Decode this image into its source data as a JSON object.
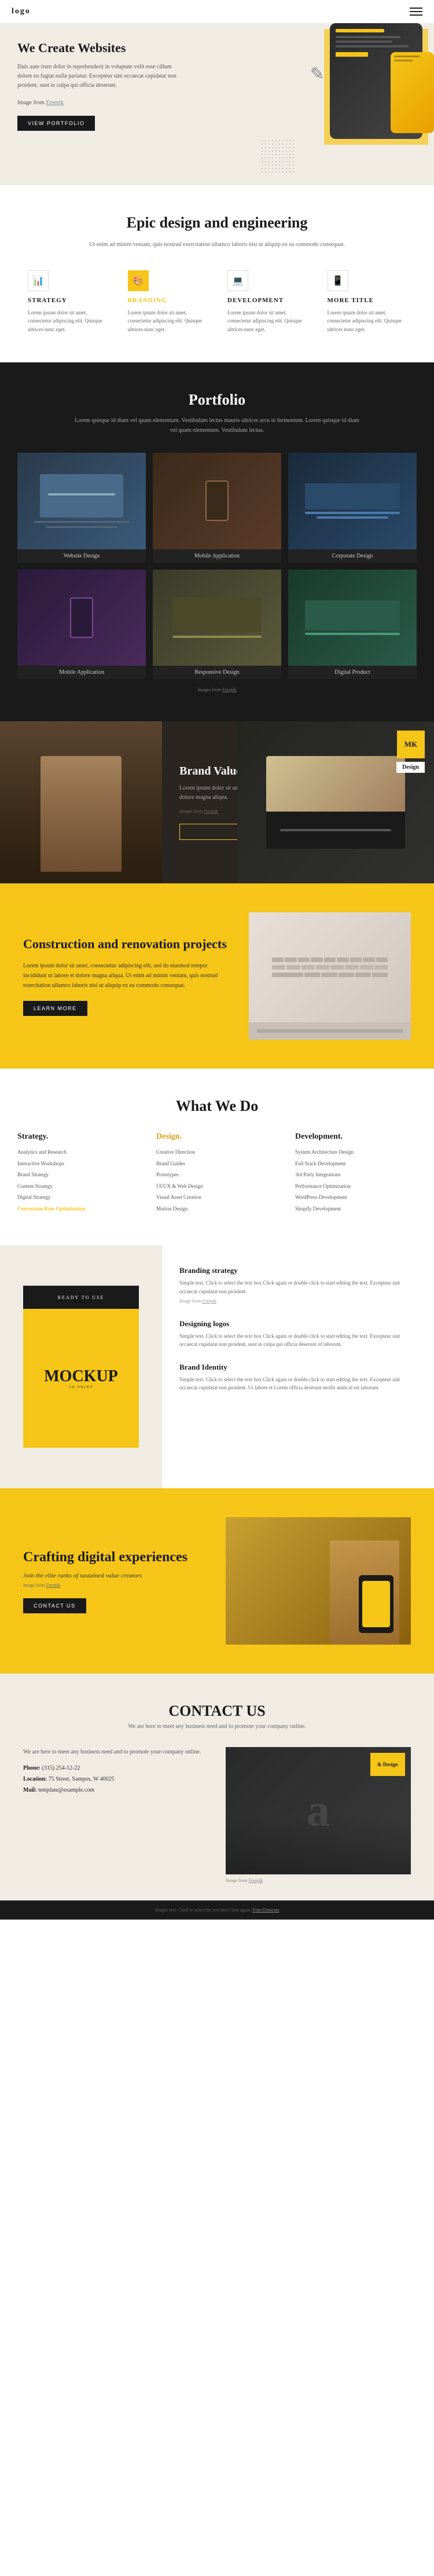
{
  "header": {
    "logo": "logo",
    "menu_aria": "Open menu"
  },
  "hero": {
    "title": "We Create Websites",
    "description": "Duis aute irure dolor in reprehenderit in voluptate velit esse cillum dolore eu fugiat nulla pariatur. Excepteur sint occaecat cupidatat non proident, sunt in culpa qui officia deserunt.",
    "image_credit_text": "Image from",
    "image_credit_link": "Freepik",
    "cta_button": "VIEW PORTFOLIO"
  },
  "epic_design": {
    "title": "Epic design and engineering",
    "subtitle": "Ut enim ad minim veniam, quis nostrud exercitation ullamco laboris nisi ut aliquip ex ea commodo consequat.",
    "features": [
      {
        "icon": "📊",
        "title": "STRATEGY",
        "text": "Lorem ipsum dolor sit amet, consectetur adipiscing elit. Quisque ultrices nunc eget."
      },
      {
        "icon": "🎨",
        "title": "BRANDING",
        "text": "Lorem ipsum dolor sit amet, consectetur adipiscing elit. Quisque ultrices nunc eget."
      },
      {
        "icon": "💻",
        "title": "DEVELOPMENT",
        "text": "Lorem ipsum dolor sit amet, consectetur adipiscing elit. Quisque ultrices nunc eget."
      },
      {
        "icon": "📱",
        "title": "MORE TITLE",
        "text": "Lorem ipsum dolor sit amet, consectetur adipiscing elit. Quisque ultrices nunc eget."
      }
    ]
  },
  "portfolio": {
    "title": "Portfolio",
    "subtitle": "Lorem quisque id diam vel quam elementum. Vestibulum lectus mauris ultrices arcu in fermentum. Lorem quisque id diam vel quam elementum. Vestibulum lectus.",
    "items": [
      {
        "label": "Website Design"
      },
      {
        "label": "Mobile Application"
      },
      {
        "label": "Corporate Design"
      },
      {
        "label": "Mobile Application"
      },
      {
        "label": "Responsive Design"
      },
      {
        "label": "Digital Product"
      }
    ],
    "credit_text": "Images from",
    "credit_link": "Freepik"
  },
  "brand_values": {
    "title": "Brand Values",
    "description": "Lorem ipsum dolor sit amet, consectetur adipiscing elit, sed do eiusmod tempor incididunt ut labore et dolore magna aliqua.",
    "credit_text": "Images from",
    "credit_link": "Freepik",
    "cta_button": "LEARN MORE",
    "badge_mk": "MK",
    "badge_design": "Design"
  },
  "construction": {
    "title": "Construction and renovation projects",
    "description": "Lorem ipsum dolor sit amet, consectetur adipiscing elit, sed do eiusmod tempor incididunt ut labore et dolore magna aliqua. Ut enim ad minim veniam, quis nostrud exercitation ullamco laboris nisi ut aliquip ex ea commodo consequat.",
    "cta_button": "LEARN MORE"
  },
  "what_we_do": {
    "title": "What We Do",
    "columns": [
      {
        "heading": "Strategy.",
        "items": [
          "Analytics and Research",
          "Interactive Workshops",
          "Brand Strategy",
          "Content Strategy",
          "Digital Strategy",
          "Conversion Rate Optimization"
        ]
      },
      {
        "heading": "Design.",
        "items": [
          "Creative Direction",
          "Brand Guides",
          "Prototypes",
          "UI/UX & Web Design",
          "Visual Asset Creation",
          "Motion Design"
        ]
      },
      {
        "heading": "Development.",
        "items": [
          "System Architecture Design",
          "Full Stack Development",
          "3rd Party Integrations",
          "Performance Optimization",
          "WordPress Development",
          "Shopify Development"
        ]
      }
    ]
  },
  "branding_section": {
    "mockup_label": "READY TO USE",
    "mockup_text": "MOCKUP",
    "mockup_to_print": "TO PRINT",
    "items": [
      {
        "title": "Branding strategy",
        "text": "Simple text. Click to select the text box Click again or double click to start editing the text. Excepteur sint occaecat cupidatat non proident.",
        "credit_text": "Image from",
        "credit_link": "Freepik"
      },
      {
        "title": "Designing logos",
        "text": "Simple text. Click to select the text box Click again or double click to start editing the text. Excepteur sint occaecat cupidatat non proident, sunt in culpa qui officia deserunt of laborum.",
        "credit_text": "",
        "credit_link": ""
      },
      {
        "title": "Brand Identity",
        "text": "Simple text. Click to select the text box Click again or double click to start editing the text. Excepteur sint occaecat cupidatat non proident. Ut labore et Lorem officia deserunt mollit anim id est laborum.",
        "credit_text": "",
        "credit_link": ""
      }
    ]
  },
  "crafting": {
    "title": "Crafting digital experiences",
    "subtitle": "Join the elite ranks of sustained value creators",
    "credit_text": "Image from",
    "credit_link": "Freepik",
    "cta_button": "CONTACT US"
  },
  "contact": {
    "title": "CONTACT US",
    "subtitle": "We are here to meet any business need and to promote your company online.",
    "phone_label": "Phone:",
    "phone_value": "(315) 254-12-22",
    "location_label": "Location:",
    "location_value": "75 Street, Sampos, W 40025",
    "mail_label": "Mail:",
    "mail_value": "template@example.com",
    "credit_text": "Image from",
    "credit_link": "Freepik",
    "badge": "& Design"
  },
  "footer": {
    "text": "Simple text. Click to select the text box Click again.",
    "link_text": "Font Elements"
  }
}
